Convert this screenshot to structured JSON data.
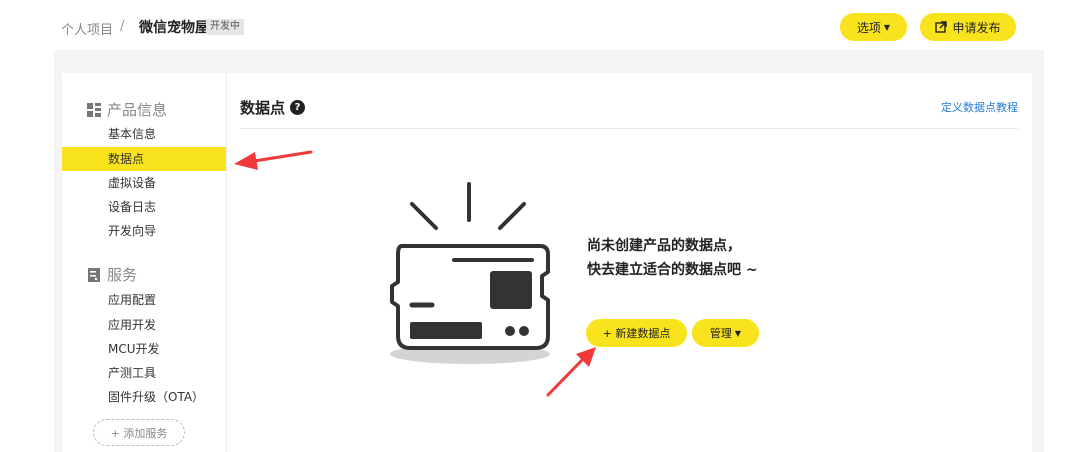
{
  "header": {
    "breadcrumb_root": "个人项目",
    "breadcrumb_sep": "/",
    "project_name": "微信宠物屋",
    "status_tag": "开发中",
    "options_label": "选项",
    "publish_label": "申请发布"
  },
  "sidebar": {
    "product_section": "产品信息",
    "product_items": [
      "基本信息",
      "数据点",
      "虚拟设备",
      "设备日志",
      "开发向导"
    ],
    "service_section": "服务",
    "service_items": [
      "应用配置",
      "应用开发",
      "MCU开发",
      "产测工具",
      "固件升级（OTA）"
    ],
    "add_service": "+ 添加服务",
    "active_item": "数据点"
  },
  "main": {
    "title": "数据点",
    "help_icon": "?",
    "tutorial_link": "定义数据点教程",
    "empty_line1": "尚未创建产品的数据点，",
    "empty_line2": "快去建立适合的数据点吧 ~",
    "new_button": "+ 新建数据点",
    "manage_button": "管理"
  },
  "colors": {
    "accent": "#f8e31c",
    "link": "#2a7bd4",
    "arrow": "#f0393a"
  }
}
